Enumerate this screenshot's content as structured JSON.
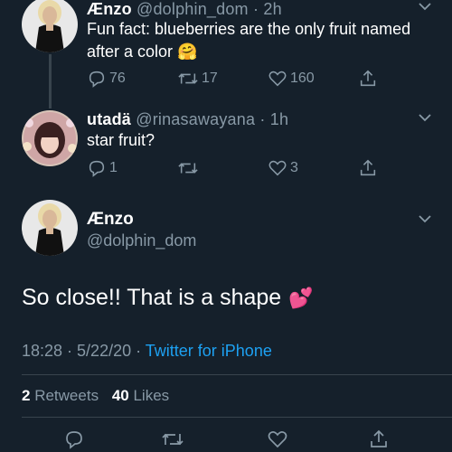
{
  "colors": {
    "background": "#15202b",
    "text": "#ffffff",
    "muted": "#8899a6",
    "link": "#1da1f2",
    "divider": "#38444d"
  },
  "tweet1": {
    "name": "Ænzo",
    "handle": "@dolphin_dom",
    "time": "· 2h",
    "text": "Fun fact: blueberries are the only fruit named after a color",
    "emoji": "🤗",
    "replies": "76",
    "retweets": "17",
    "likes": "160"
  },
  "tweet2": {
    "name": "utadä",
    "handle": "@rinasawayana",
    "time": "· 1h",
    "text": "star fruit?",
    "replies": "1",
    "retweets": "",
    "likes": "3"
  },
  "main_tweet": {
    "name": "Ænzo",
    "handle": "@dolphin_dom",
    "text": "So close!! That is a shape",
    "emoji": "💕",
    "timestamp": "18:28 · 5/22/20 · ",
    "source": "Twitter for iPhone",
    "retweets_count": "2",
    "retweets_label": "Retweets",
    "likes_count": "40",
    "likes_label": "Likes"
  },
  "icons": {
    "reply": "reply-icon",
    "retweet": "retweet-icon",
    "like": "heart-icon",
    "share": "share-icon",
    "more": "chevron-down-icon"
  }
}
